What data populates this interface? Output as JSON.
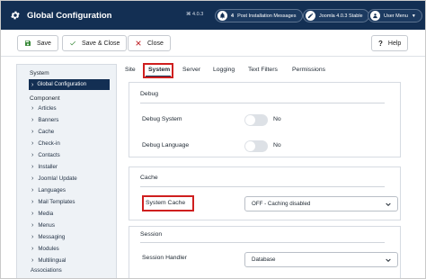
{
  "header": {
    "title": "Global Configuration",
    "version": "⌘ 4.0.3",
    "post_install": {
      "count": "4",
      "label": "Post Installation Messages"
    },
    "joomla_stable": "Joomla 4.0.3 Stable",
    "user_menu": "User Menu"
  },
  "toolbar": {
    "save": "Save",
    "save_close": "Save & Close",
    "close": "Close",
    "help": "Help"
  },
  "sidebar": {
    "system_heading": "System",
    "global_config": "Global Configuration",
    "component_heading": "Component",
    "items": [
      "Articles",
      "Banners",
      "Cache",
      "Check-in",
      "Contacts",
      "Installer",
      "Joomla! Update",
      "Languages",
      "Mail Templates",
      "Media",
      "Menus",
      "Messaging",
      "Modules",
      "Multilingual",
      "Associations"
    ]
  },
  "tabs": [
    "Site",
    "System",
    "Server",
    "Logging",
    "Text Filters",
    "Permissions"
  ],
  "debug": {
    "legend": "Debug",
    "system_label": "Debug System",
    "system_value": "No",
    "language_label": "Debug Language",
    "language_value": "No"
  },
  "cache": {
    "legend": "Cache",
    "system_cache_label": "System Cache",
    "system_cache_value": "OFF - Caching disabled"
  },
  "session": {
    "legend": "Session",
    "handler_label": "Session Handler",
    "handler_value": "Database"
  },
  "colors": {
    "header_bg": "#132f53",
    "highlight": "#cf1f1f",
    "sidebar_bg": "#eef2f6"
  }
}
